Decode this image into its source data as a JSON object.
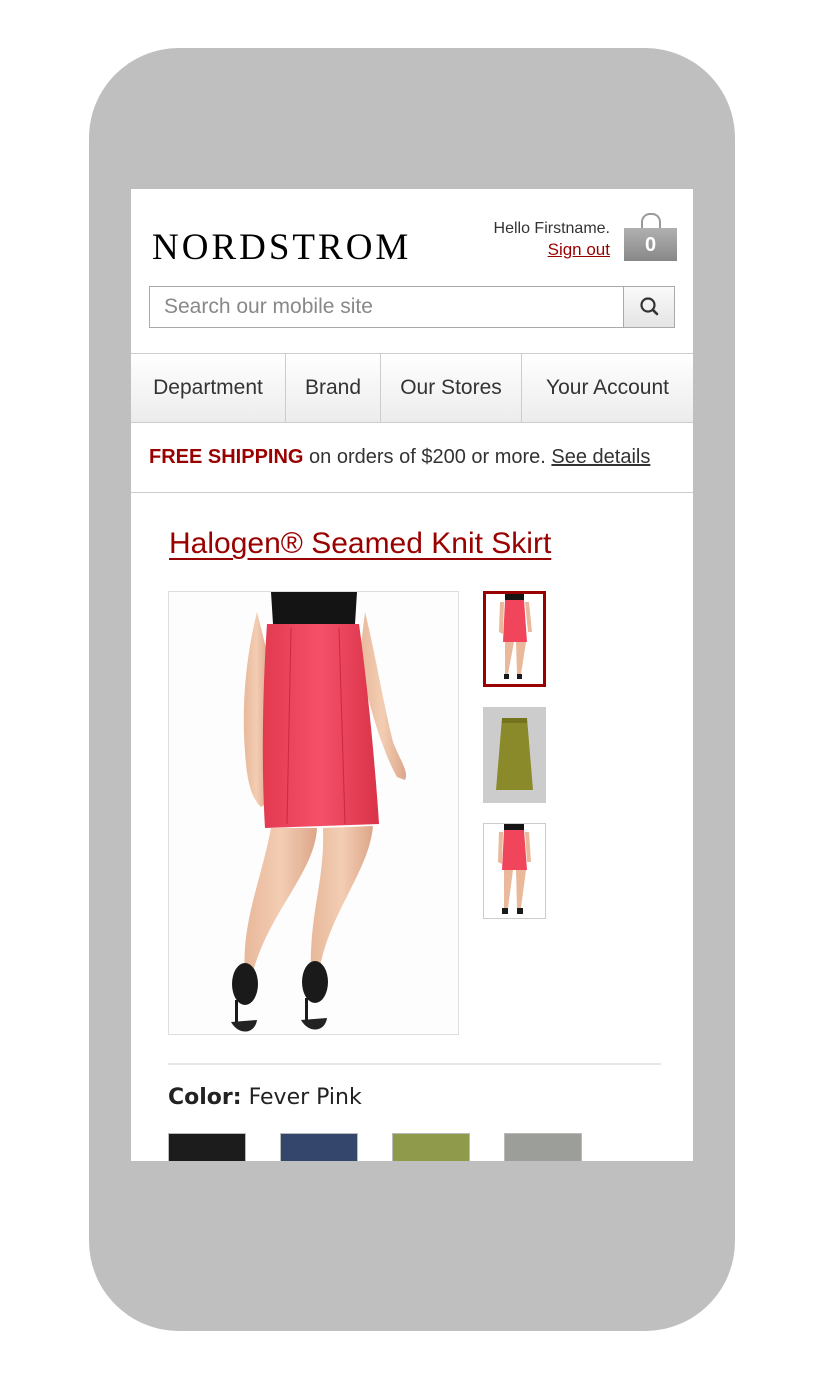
{
  "header": {
    "logo": "NORDSTROM",
    "greeting": "Hello Firstname.",
    "sign_out": "Sign out",
    "bag_count": "0"
  },
  "search": {
    "placeholder": "Search our mobile site",
    "icon": "search-icon"
  },
  "nav": {
    "tabs": [
      {
        "label": "Department"
      },
      {
        "label": "Brand"
      },
      {
        "label": "Our Stores"
      },
      {
        "label": "Your Account"
      }
    ]
  },
  "promo": {
    "highlight": "FREE SHIPPING",
    "text": " on orders of $200 or more. ",
    "link": "See details"
  },
  "product": {
    "title": "Halogen® Seamed Knit Skirt",
    "color_label": "Color:",
    "color_value": "Fever Pink",
    "swatches": [
      {
        "name": "black",
        "color": "#1c1c1c"
      },
      {
        "name": "navy",
        "color": "#34466b"
      },
      {
        "name": "olive",
        "color": "#8f9a4a"
      },
      {
        "name": "gray",
        "color": "#9c9e9a"
      }
    ]
  },
  "colors": {
    "accent": "#990000",
    "skirt_pink": "#f0455a",
    "skirt_olive": "#8a8a2a"
  }
}
